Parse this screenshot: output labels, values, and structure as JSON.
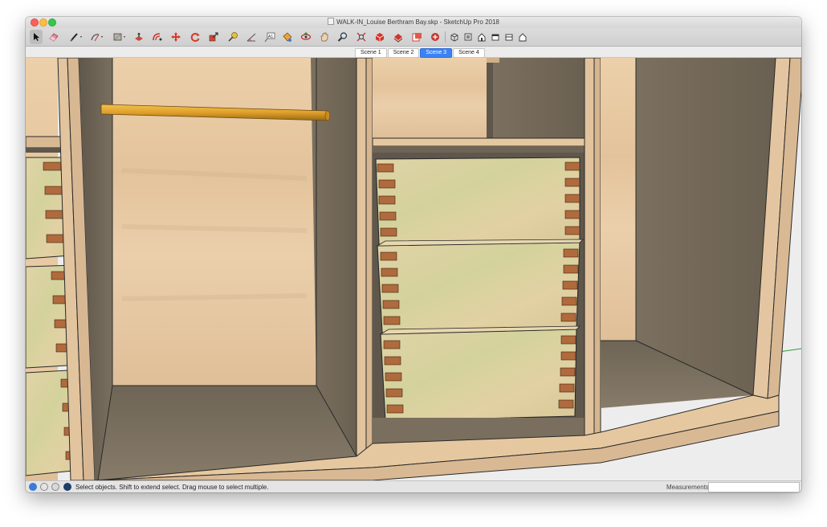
{
  "window": {
    "title": "WALK-IN_Louise Berthram Bay.skp - SketchUp Pro 2018"
  },
  "toolbar": {
    "tools": [
      "select-tool",
      "eraser-tool",
      "line-tool",
      "arc-tool",
      "rectangle-tool",
      "push-pull-tool",
      "offset-tool",
      "move-tool",
      "rotate-tool",
      "scale-tool",
      "tape-measure-tool",
      "protractor-tool",
      "text-tool",
      "paint-bucket-tool",
      "orbit-tool",
      "pan-tool",
      "zoom-tool",
      "zoom-extents-tool",
      "3d-warehouse",
      "extension-warehouse",
      "layout-send",
      "extension-manager",
      "iso-view",
      "top-view",
      "front-view",
      "right-view",
      "back-view",
      "left-view"
    ]
  },
  "scenes": {
    "tabs": [
      "Scene 1",
      "Scene 2",
      "Scene 3",
      "Scene 4"
    ],
    "active": "Scene 3"
  },
  "status": {
    "text": "Select objects. Shift to extend select. Drag mouse to select multiple.",
    "measurements_label": "Measurements",
    "measurements_value": ""
  },
  "colors": {
    "wood": "#e8c9a2",
    "wood_dark": "#6e6556",
    "drawer_front": "#d9d6a4",
    "dovetail": "#b06a3c",
    "rod": "#e3a32a",
    "scene_active": "#3b82f6",
    "green_axis": "#2e9b3a"
  }
}
